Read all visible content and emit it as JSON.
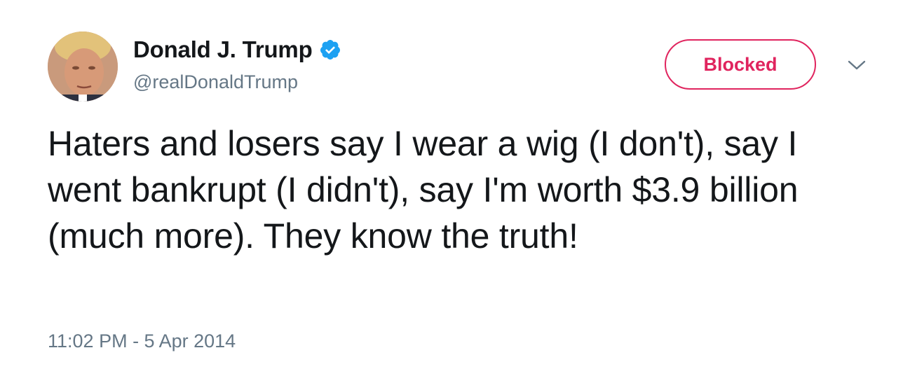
{
  "tweet": {
    "author": {
      "display_name": "Donald J. Trump",
      "handle": "@realDonaldTrump",
      "verified": true,
      "avatar_icon": "profile-photo"
    },
    "follow_button_label": "Blocked",
    "menu_icon": "chevron-down-icon",
    "text": "Haters and losers say I wear a wig (I don't), say I went bankrupt (I didn't), say I'm worth $3.9 billion (much more). They know the truth!",
    "timestamp": "11:02 PM - 5 Apr 2014"
  },
  "colors": {
    "text_primary": "#14171a",
    "text_secondary": "#657786",
    "blocked_accent": "#e0245e",
    "verified_blue": "#1da1f2"
  }
}
